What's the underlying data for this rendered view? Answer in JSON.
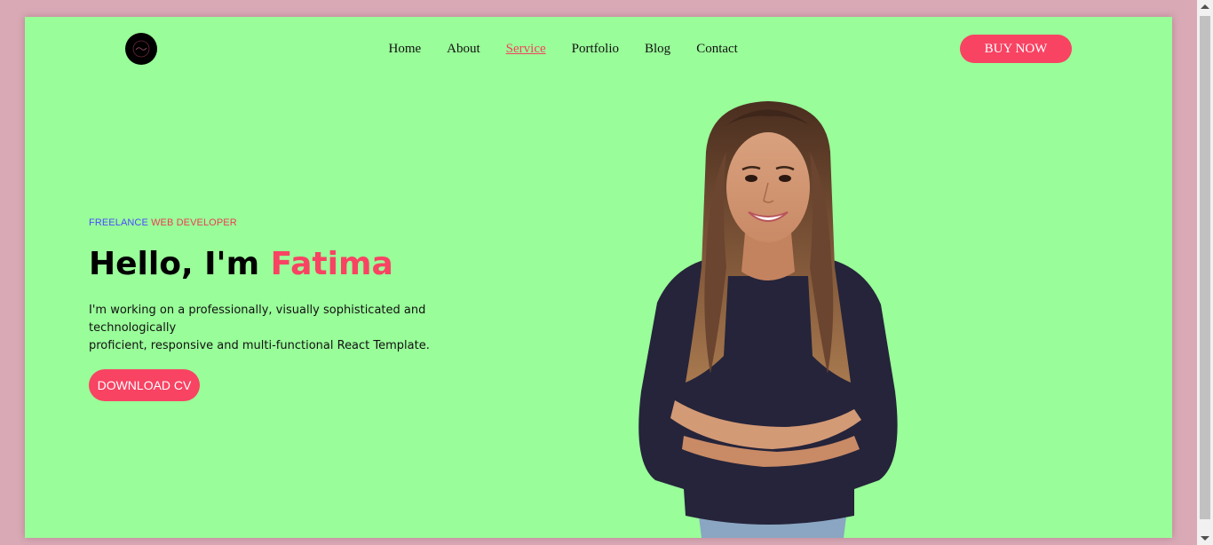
{
  "nav": {
    "items": [
      {
        "label": "Home"
      },
      {
        "label": "About"
      },
      {
        "label": "Service",
        "active": true
      },
      {
        "label": "Portfolio"
      },
      {
        "label": "Blog"
      },
      {
        "label": "Contact"
      }
    ]
  },
  "header": {
    "logo_icon": "circle-logo-icon",
    "buy_label": "BUY NOW"
  },
  "hero": {
    "subtitle_part1": "FREELANCE",
    "subtitle_part2": "WEB DEVELOPER",
    "greeting": "Hello, I'm",
    "name": "Fatima",
    "description_line1": "I'm working on a professionally, visually sophisticated and technologically",
    "description_line2": "proficient, responsive and multi-functional React Template.",
    "cta_label": "DOWNLOAD CV",
    "photo": "woman-portrait-image"
  },
  "colors": {
    "page_bg": "#99fd99",
    "outer_bg": "#d9a9b6",
    "accent": "#f84363",
    "subtitle_blue": "#4b4bff"
  }
}
